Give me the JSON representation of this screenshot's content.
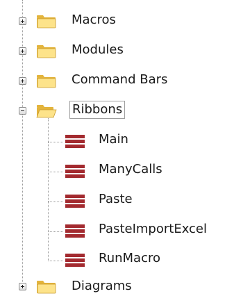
{
  "tree": {
    "items": [
      {
        "label": "Macros",
        "icon": "folder-icon",
        "expander": "expand-icon"
      },
      {
        "label": "Modules",
        "icon": "folder-icon",
        "expander": "expand-icon"
      },
      {
        "label": "Command Bars",
        "icon": "folder-icon",
        "expander": "expand-icon"
      },
      {
        "label": "Ribbons",
        "icon": "open-folder-icon",
        "expander": "collapse-icon",
        "selected": true,
        "children": [
          {
            "label": "Main",
            "icon": "ribbon-icon"
          },
          {
            "label": "ManyCalls",
            "icon": "ribbon-icon"
          },
          {
            "label": "Paste",
            "icon": "ribbon-icon"
          },
          {
            "label": "PasteImportExcel",
            "icon": "ribbon-icon"
          },
          {
            "label": "RunMacro",
            "icon": "ribbon-icon"
          }
        ]
      },
      {
        "label": "Diagrams",
        "icon": "folder-icon",
        "expander": "expand-icon"
      }
    ]
  },
  "colors": {
    "folder_light": "#fde38a",
    "folder_dark": "#e3b43c",
    "ribbon_item": "#a32a2f",
    "tree_line": "#9a9a9a"
  }
}
